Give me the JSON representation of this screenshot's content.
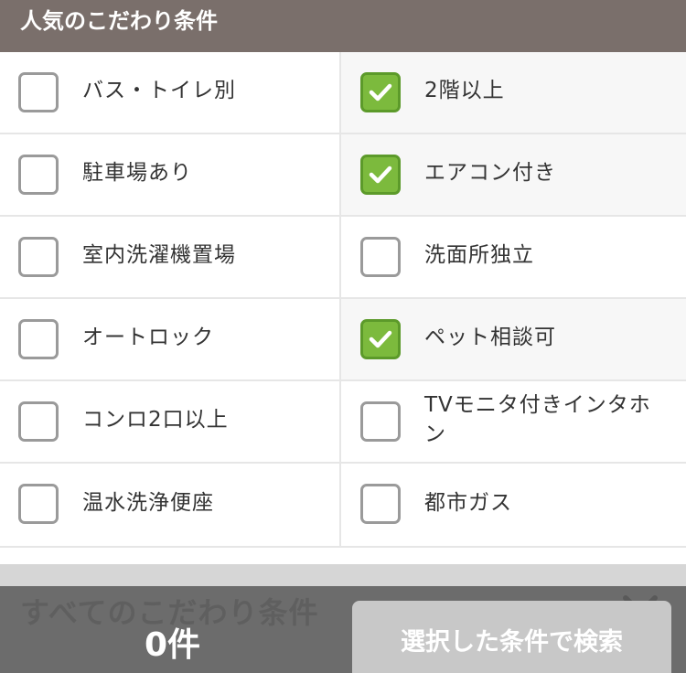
{
  "header": {
    "title": "人気のこだわり条件"
  },
  "conditions": [
    [
      {
        "label": "バス・トイレ別",
        "checked": false
      },
      {
        "label": "2階以上",
        "checked": true
      }
    ],
    [
      {
        "label": "駐車場あり",
        "checked": false
      },
      {
        "label": "エアコン付き",
        "checked": true
      }
    ],
    [
      {
        "label": "室内洗濯機置場",
        "checked": false
      },
      {
        "label": "洗面所独立",
        "checked": false
      }
    ],
    [
      {
        "label": "オートロック",
        "checked": false
      },
      {
        "label": "ペット相談可",
        "checked": true
      }
    ],
    [
      {
        "label": "コンロ2口以上",
        "checked": false
      },
      {
        "label": "TVモニタ付きインタホン",
        "checked": false
      }
    ],
    [
      {
        "label": "温水洗浄便座",
        "checked": false
      },
      {
        "label": "都市ガス",
        "checked": false
      }
    ]
  ],
  "footer": {
    "background_title": "すべてのこだわり条件",
    "result_count": "0件",
    "search_button_label": "選択した条件で検索"
  },
  "colors": {
    "header_bg": "#7a6f6b",
    "checked_green": "#7cba3d",
    "bottom_bar": "#6c6c6c",
    "button_disabled": "#c8c8c8"
  }
}
